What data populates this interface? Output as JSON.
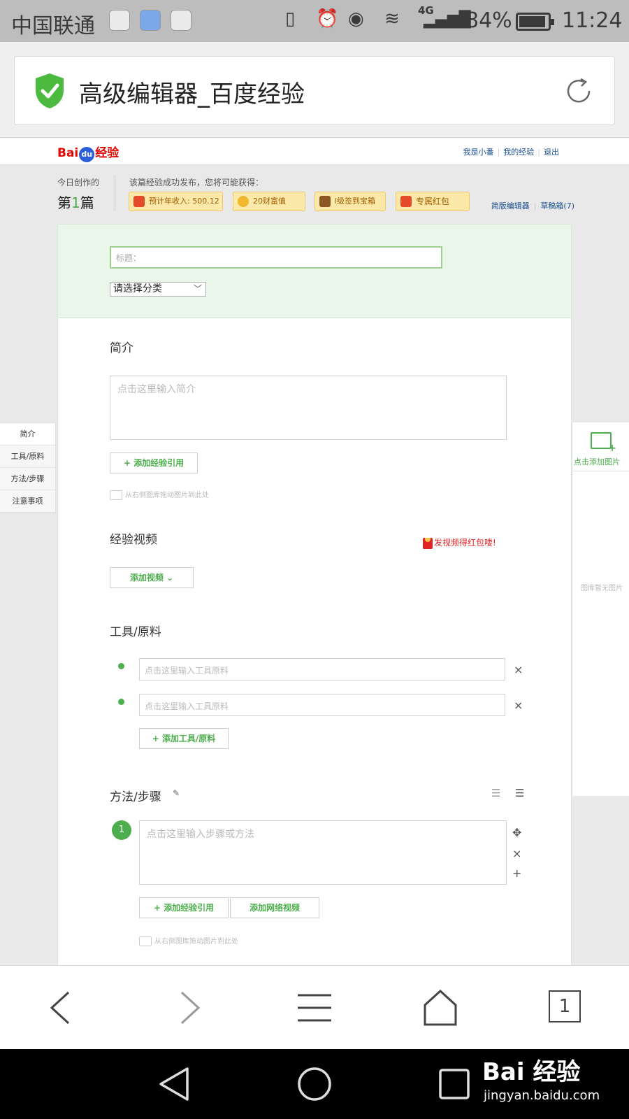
{
  "status_bar": {
    "carrier": "中国联通",
    "battery_percent": "84%",
    "battery_level": 0.84,
    "network": "4G",
    "time": "11:24"
  },
  "address_bar": {
    "page_title": "高级编辑器_百度经验",
    "secure_icon": "green-shield-check-icon",
    "reload_icon": "reload-icon"
  },
  "site_header": {
    "logo_bai": "Bai",
    "logo_du": "du",
    "logo_jingyan": "经验",
    "user_links": [
      "我是小番",
      "我的经验",
      "退出"
    ]
  },
  "info_bar": {
    "today_label": "今日创作的",
    "today_prefix": "第",
    "today_number": "1",
    "today_suffix": "篇",
    "publish_label": "该篇经验成功发布，您将可能获得：",
    "rewards": [
      "预计年收入: 500.12",
      "20财富值",
      "l级签到宝箱",
      "专属红包"
    ],
    "editor_links": [
      "简版编辑器",
      "草稿箱(7)"
    ]
  },
  "form": {
    "title_placeholder": "标题：",
    "category_selected": "请选择分类",
    "intro": {
      "heading": "简介",
      "placeholder": "点击这里输入简介",
      "add_reference": "+ 添加经验引用",
      "drag_tip": "从右侧图库拖动图片到此处"
    },
    "video": {
      "heading": "经验视频",
      "add_video": "添加视频",
      "promo": "发视频得红包喽!"
    },
    "tools": {
      "heading": "工具/原料",
      "placeholder": "点击这里输入工具原料",
      "add_tool": "+ 添加工具/原料",
      "delete": "×"
    },
    "steps": {
      "heading": "方法/步骤",
      "step_number": "1",
      "placeholder": "点击这里输入步骤或方法",
      "add_reference": "+ 添加经验引用",
      "add_web_video": "添加网络视频",
      "drag_tip": "从右侧图库拖动图片到此处",
      "move": "✥",
      "delete": "×",
      "add": "+",
      "list_ordered": "☰",
      "list_bullet": "☰"
    }
  },
  "side_nav": [
    "简介",
    "工具/原料",
    "方法/步骤",
    "注意事项"
  ],
  "image_panel": {
    "add_label": "点击添加图片",
    "empty_text": "图库暂无图片"
  },
  "browser_toolbar": {
    "tab_count": "1"
  },
  "watermark": {
    "brand": "Bai 经验",
    "url": "jingyan.baidu.com"
  }
}
